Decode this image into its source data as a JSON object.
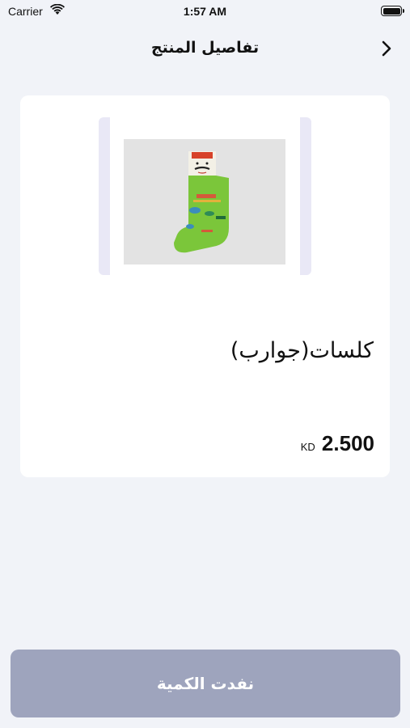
{
  "status_bar": {
    "carrier": "Carrier",
    "time": "1:57 AM"
  },
  "header": {
    "title": "تفاصيل المنتج",
    "back_icon": "chevron-right-icon"
  },
  "product": {
    "name": "كلسات(جوارب)",
    "price": "2.500",
    "currency": "KD"
  },
  "footer": {
    "button_label": "نفدت الكمية"
  },
  "colors": {
    "background": "#f1f3f8",
    "card": "#ffffff",
    "button_disabled": "#9ea4bd",
    "image_frame": "#e9e8f6"
  }
}
